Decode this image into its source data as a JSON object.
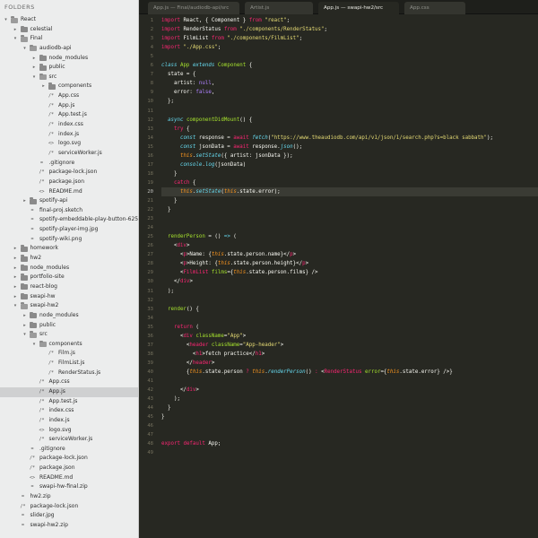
{
  "sidebar": {
    "title": "FOLDERS",
    "items": [
      {
        "label": "React",
        "depth": 0,
        "type": "folder",
        "open": true
      },
      {
        "label": "celestial",
        "depth": 1,
        "type": "folder",
        "open": false
      },
      {
        "label": "Final",
        "depth": 1,
        "type": "folder",
        "open": true
      },
      {
        "label": "audiodb-api",
        "depth": 2,
        "type": "folder",
        "open": true
      },
      {
        "label": "node_modules",
        "depth": 3,
        "type": "folder",
        "open": false
      },
      {
        "label": "public",
        "depth": 3,
        "type": "folder",
        "open": false
      },
      {
        "label": "src",
        "depth": 3,
        "type": "folder",
        "open": true
      },
      {
        "label": "components",
        "depth": 4,
        "type": "folder",
        "open": false
      },
      {
        "label": "App.css",
        "depth": 4,
        "type": "file",
        "glyph": "/*"
      },
      {
        "label": "App.js",
        "depth": 4,
        "type": "file",
        "glyph": "/*"
      },
      {
        "label": "App.test.js",
        "depth": 4,
        "type": "file",
        "glyph": "/*"
      },
      {
        "label": "index.css",
        "depth": 4,
        "type": "file",
        "glyph": "/*"
      },
      {
        "label": "index.js",
        "depth": 4,
        "type": "file",
        "glyph": "/*"
      },
      {
        "label": "logo.svg",
        "depth": 4,
        "type": "file",
        "glyph": "<>"
      },
      {
        "label": "serviceWorker.js",
        "depth": 4,
        "type": "file",
        "glyph": "/*"
      },
      {
        "label": ".gitignore",
        "depth": 3,
        "type": "file",
        "glyph": "="
      },
      {
        "label": "package-lock.json",
        "depth": 3,
        "type": "file",
        "glyph": "/*"
      },
      {
        "label": "package.json",
        "depth": 3,
        "type": "file",
        "glyph": "/*"
      },
      {
        "label": "README.md",
        "depth": 3,
        "type": "file",
        "glyph": "<>"
      },
      {
        "label": "spotify-api",
        "depth": 2,
        "type": "folder",
        "open": false
      },
      {
        "label": "final-proj.sketch",
        "depth": 2,
        "type": "file",
        "glyph": "="
      },
      {
        "label": "spotify-embeddable-play-button-625x294.jpg",
        "depth": 2,
        "type": "file",
        "glyph": "="
      },
      {
        "label": "spotify-player-img.jpg",
        "depth": 2,
        "type": "file",
        "glyph": "="
      },
      {
        "label": "spotify-wiki.png",
        "depth": 2,
        "type": "file",
        "glyph": "="
      },
      {
        "label": "homework",
        "depth": 1,
        "type": "folder",
        "open": false
      },
      {
        "label": "hw2",
        "depth": 1,
        "type": "folder",
        "open": false
      },
      {
        "label": "node_modules",
        "depth": 1,
        "type": "folder",
        "open": false
      },
      {
        "label": "portfolio-site",
        "depth": 1,
        "type": "folder",
        "open": false
      },
      {
        "label": "react-blog",
        "depth": 1,
        "type": "folder",
        "open": false
      },
      {
        "label": "swapi-hw",
        "depth": 1,
        "type": "folder",
        "open": false
      },
      {
        "label": "swapi-hw2",
        "depth": 1,
        "type": "folder",
        "open": true
      },
      {
        "label": "node_modules",
        "depth": 2,
        "type": "folder",
        "open": false
      },
      {
        "label": "public",
        "depth": 2,
        "type": "folder",
        "open": false
      },
      {
        "label": "src",
        "depth": 2,
        "type": "folder",
        "open": true
      },
      {
        "label": "components",
        "depth": 3,
        "type": "folder",
        "open": true
      },
      {
        "label": "Film.js",
        "depth": 4,
        "type": "file",
        "glyph": "/*"
      },
      {
        "label": "FilmList.js",
        "depth": 4,
        "type": "file",
        "glyph": "/*"
      },
      {
        "label": "RenderStatus.js",
        "depth": 4,
        "type": "file",
        "glyph": "/*"
      },
      {
        "label": "App.css",
        "depth": 3,
        "type": "file",
        "glyph": "/*"
      },
      {
        "label": "App.js",
        "depth": 3,
        "type": "file",
        "glyph": "/*",
        "selected": true
      },
      {
        "label": "App.test.js",
        "depth": 3,
        "type": "file",
        "glyph": "/*"
      },
      {
        "label": "index.css",
        "depth": 3,
        "type": "file",
        "glyph": "/*"
      },
      {
        "label": "index.js",
        "depth": 3,
        "type": "file",
        "glyph": "/*"
      },
      {
        "label": "logo.svg",
        "depth": 3,
        "type": "file",
        "glyph": "<>"
      },
      {
        "label": "serviceWorker.js",
        "depth": 3,
        "type": "file",
        "glyph": "/*"
      },
      {
        "label": ".gitignore",
        "depth": 2,
        "type": "file",
        "glyph": "="
      },
      {
        "label": "package-lock.json",
        "depth": 2,
        "type": "file",
        "glyph": "/*"
      },
      {
        "label": "package.json",
        "depth": 2,
        "type": "file",
        "glyph": "/*"
      },
      {
        "label": "README.md",
        "depth": 2,
        "type": "file",
        "glyph": "<>"
      },
      {
        "label": "swapi-hw-final.zip",
        "depth": 2,
        "type": "file",
        "glyph": "="
      },
      {
        "label": "hw2.zip",
        "depth": 1,
        "type": "file",
        "glyph": "="
      },
      {
        "label": "package-lock.json",
        "depth": 1,
        "type": "file",
        "glyph": "/*"
      },
      {
        "label": "slider.jpg",
        "depth": 1,
        "type": "file",
        "glyph": "="
      },
      {
        "label": "swapi-hw2.zip",
        "depth": 1,
        "type": "file",
        "glyph": "="
      }
    ]
  },
  "tabs": [
    {
      "label": "App.js — Final/audiodb-api/src",
      "active": false
    },
    {
      "label": "Artist.js",
      "active": false
    },
    {
      "label": "App.js — swapi-hw2/src",
      "active": true
    },
    {
      "label": "App.css",
      "active": false
    }
  ],
  "editor": {
    "current_line": 20,
    "lines": [
      [
        [
          "k",
          "import"
        ],
        [
          "p",
          " React, { Component } "
        ],
        [
          "k",
          "from"
        ],
        [
          "p",
          " "
        ],
        [
          "s",
          "\"react\""
        ],
        [
          "p",
          ";"
        ]
      ],
      [
        [
          "k",
          "import"
        ],
        [
          "p",
          " RenderStatus "
        ],
        [
          "k",
          "from"
        ],
        [
          "p",
          " "
        ],
        [
          "s",
          "\"./components/RenderStatus\""
        ],
        [
          "p",
          ";"
        ]
      ],
      [
        [
          "k",
          "import"
        ],
        [
          "p",
          " FilmList "
        ],
        [
          "k",
          "from"
        ],
        [
          "p",
          " "
        ],
        [
          "s",
          "\"./components/FilmList\""
        ],
        [
          "p",
          ";"
        ]
      ],
      [
        [
          "k",
          "import"
        ],
        [
          "p",
          " "
        ],
        [
          "s",
          "\"./App.css\""
        ],
        [
          "p",
          ";"
        ]
      ],
      [],
      [
        [
          "t",
          "class"
        ],
        [
          "p",
          " "
        ],
        [
          "c",
          "App"
        ],
        [
          "p",
          " "
        ],
        [
          "t",
          "extends"
        ],
        [
          "p",
          " "
        ],
        [
          "c",
          "Component"
        ],
        [
          "p",
          " {"
        ]
      ],
      [
        [
          "p",
          "  state = {"
        ]
      ],
      [
        [
          "p",
          "    artist: "
        ],
        [
          "v",
          "null"
        ],
        [
          "p",
          ","
        ]
      ],
      [
        [
          "p",
          "    error: "
        ],
        [
          "v",
          "false"
        ],
        [
          "p",
          ","
        ]
      ],
      [
        [
          "p",
          "  };"
        ]
      ],
      [],
      [
        [
          "p",
          "  "
        ],
        [
          "t",
          "async"
        ],
        [
          "p",
          " "
        ],
        [
          "f",
          "componentDidMount"
        ],
        [
          "p",
          "() {"
        ]
      ],
      [
        [
          "p",
          "    "
        ],
        [
          "k",
          "try"
        ],
        [
          "p",
          " {"
        ]
      ],
      [
        [
          "p",
          "      "
        ],
        [
          "t",
          "const"
        ],
        [
          "p",
          " response = "
        ],
        [
          "k",
          "await"
        ],
        [
          "p",
          " "
        ],
        [
          "t",
          "fetch"
        ],
        [
          "p",
          "("
        ],
        [
          "s",
          "\"https://www.theaudiodb.com/api/v1/json/1/search.php?s=black sabbath\""
        ],
        [
          "p",
          ");"
        ]
      ],
      [
        [
          "p",
          "      "
        ],
        [
          "t",
          "const"
        ],
        [
          "p",
          " jsonData = "
        ],
        [
          "k",
          "await"
        ],
        [
          "p",
          " response."
        ],
        [
          "t",
          "json"
        ],
        [
          "p",
          "();"
        ]
      ],
      [
        [
          "p",
          "      "
        ],
        [
          "i",
          "this"
        ],
        [
          "p",
          "."
        ],
        [
          "t",
          "setState"
        ],
        [
          "p",
          "({ artist: jsonData });"
        ]
      ],
      [
        [
          "p",
          "      "
        ],
        [
          "t",
          "console"
        ],
        [
          "p",
          "."
        ],
        [
          "t",
          "log"
        ],
        [
          "p",
          "(jsonData)"
        ]
      ],
      [
        [
          "p",
          "    }"
        ]
      ],
      [
        [
          "p",
          "    "
        ],
        [
          "k",
          "catch"
        ],
        [
          "p",
          " {"
        ]
      ],
      [
        [
          "p",
          "      "
        ],
        [
          "i",
          "this"
        ],
        [
          "p",
          "."
        ],
        [
          "t",
          "setState"
        ],
        [
          "p",
          "("
        ],
        [
          "i",
          "this"
        ],
        [
          "p",
          ".state.error);"
        ]
      ],
      [
        [
          "p",
          "    }"
        ]
      ],
      [
        [
          "p",
          "  }"
        ]
      ],
      [],
      [],
      [
        [
          "p",
          "  "
        ],
        [
          "f",
          "renderPerson"
        ],
        [
          "p",
          " = () "
        ],
        [
          "t",
          "=>"
        ],
        [
          "p",
          " ("
        ]
      ],
      [
        [
          "p",
          "    <"
        ],
        [
          "k",
          "div"
        ],
        [
          "p",
          ">"
        ]
      ],
      [
        [
          "p",
          "      <"
        ],
        [
          "k",
          "p"
        ],
        [
          "p",
          ">Name: {"
        ],
        [
          "i",
          "this"
        ],
        [
          "p",
          ".state.person.name}</"
        ],
        [
          "k",
          "p"
        ],
        [
          "p",
          ">"
        ]
      ],
      [
        [
          "p",
          "      <"
        ],
        [
          "k",
          "p"
        ],
        [
          "p",
          ">Height: {"
        ],
        [
          "i",
          "this"
        ],
        [
          "p",
          ".state.person.height}</"
        ],
        [
          "k",
          "p"
        ],
        [
          "p",
          ">"
        ]
      ],
      [
        [
          "p",
          "      <"
        ],
        [
          "k",
          "FilmList"
        ],
        [
          "p",
          " "
        ],
        [
          "f",
          "films"
        ],
        [
          "p",
          "={"
        ],
        [
          "i",
          "this"
        ],
        [
          "p",
          ".state.person.films} />"
        ]
      ],
      [
        [
          "p",
          "    </"
        ],
        [
          "k",
          "div"
        ],
        [
          "p",
          ">"
        ]
      ],
      [
        [
          "p",
          "  );"
        ]
      ],
      [],
      [
        [
          "p",
          "  "
        ],
        [
          "f",
          "render"
        ],
        [
          "p",
          "() {"
        ]
      ],
      [],
      [
        [
          "p",
          "    "
        ],
        [
          "k",
          "return"
        ],
        [
          "p",
          " ("
        ]
      ],
      [
        [
          "p",
          "      <"
        ],
        [
          "k",
          "div"
        ],
        [
          "p",
          " "
        ],
        [
          "f",
          "className"
        ],
        [
          "p",
          "="
        ],
        [
          "s",
          "\"App\""
        ],
        [
          "p",
          ">"
        ]
      ],
      [
        [
          "p",
          "        <"
        ],
        [
          "k",
          "header"
        ],
        [
          "p",
          " "
        ],
        [
          "f",
          "className"
        ],
        [
          "p",
          "="
        ],
        [
          "s",
          "\"App-header\""
        ],
        [
          "p",
          ">"
        ]
      ],
      [
        [
          "p",
          "          <"
        ],
        [
          "k",
          "h1"
        ],
        [
          "p",
          ">fetch practice</"
        ],
        [
          "k",
          "h1"
        ],
        [
          "p",
          ">"
        ]
      ],
      [
        [
          "p",
          "        </"
        ],
        [
          "k",
          "header"
        ],
        [
          "p",
          ">"
        ]
      ],
      [
        [
          "p",
          "        {"
        ],
        [
          "i",
          "this"
        ],
        [
          "p",
          ".state.person "
        ],
        [
          "k",
          "?"
        ],
        [
          "p",
          " "
        ],
        [
          "i",
          "this"
        ],
        [
          "p",
          "."
        ],
        [
          "t",
          "renderPerson"
        ],
        [
          "p",
          "() "
        ],
        [
          "k",
          ":"
        ],
        [
          "p",
          " <"
        ],
        [
          "k",
          "RenderStatus"
        ],
        [
          "p",
          " "
        ],
        [
          "f",
          "error"
        ],
        [
          "p",
          "={"
        ],
        [
          "i",
          "this"
        ],
        [
          "p",
          ".state.error} />}"
        ]
      ],
      [],
      [
        [
          "p",
          "      </"
        ],
        [
          "k",
          "div"
        ],
        [
          "p",
          ">"
        ]
      ],
      [
        [
          "p",
          "    );"
        ]
      ],
      [
        [
          "p",
          "  }"
        ]
      ],
      [
        [
          "p",
          "}"
        ]
      ],
      [],
      [],
      [
        [
          "k",
          "export"
        ],
        [
          "p",
          " "
        ],
        [
          "k",
          "default"
        ],
        [
          "p",
          " App;"
        ]
      ],
      []
    ]
  }
}
